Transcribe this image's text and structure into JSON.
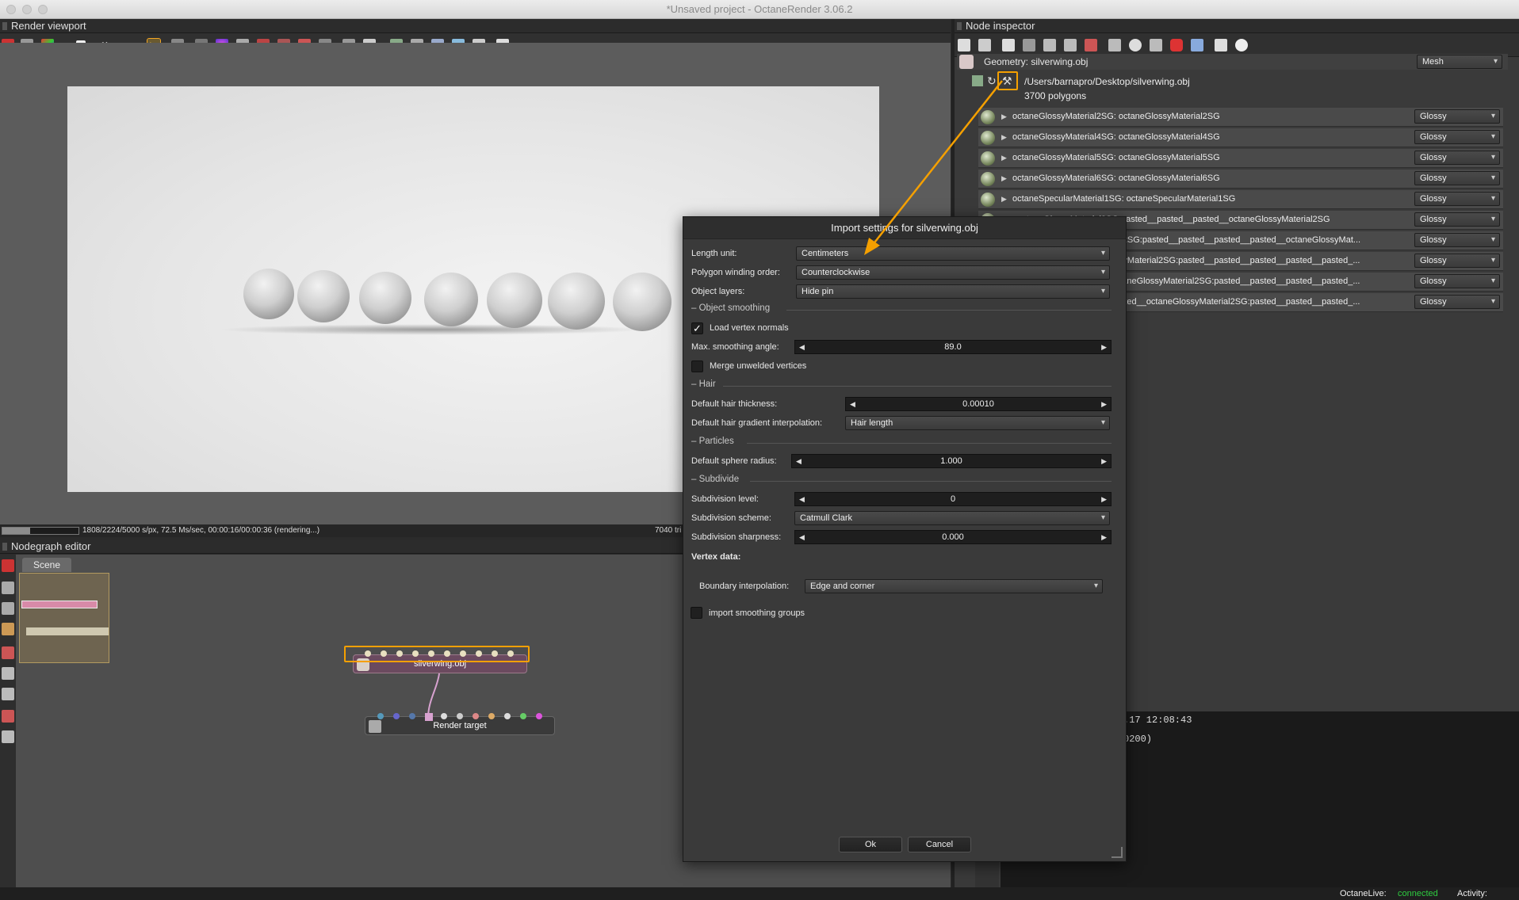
{
  "window": {
    "title": "*Unsaved project - OctaneRender 3.06.2"
  },
  "render_viewport": {
    "title": "Render viewport",
    "status": "1808/2224/5000 s/px, 72.5 Ms/sec, 00:00:16/00:00:36 (rendering...)",
    "status_right": "7040 tri",
    "progress_fraction": 0.36
  },
  "nodegraph": {
    "title": "Nodegraph editor",
    "tab": "Scene",
    "nodes": {
      "geometry": "silverwing.obj",
      "render_target": "Render target"
    }
  },
  "inspector": {
    "title": "Node inspector",
    "geometry_label": "Geometry: silverwing.obj",
    "geometry_type": "Mesh",
    "file_path": "/Users/barnapro/Desktop/silverwing.obj",
    "polygons": "3700 polygons",
    "materials": [
      {
        "label": "octaneGlossyMaterial2SG: octaneGlossyMaterial2SG",
        "type": "Glossy"
      },
      {
        "label": "octaneGlossyMaterial4SG: octaneGlossyMaterial4SG",
        "type": "Glossy"
      },
      {
        "label": "octaneGlossyMaterial5SG: octaneGlossyMaterial5SG",
        "type": "Glossy"
      },
      {
        "label": "octaneGlossyMaterial6SG: octaneGlossyMaterial6SG",
        "type": "Glossy"
      },
      {
        "label": "octaneSpecularMaterial1SG: octaneSpecularMaterial1SG",
        "type": "Glossy"
      },
      {
        "label": "_octaneGlossyMaterial2SG:pasted__pasted__pasted__octaneGlossyMaterial2SG",
        "type": "Glossy"
      },
      {
        "label": "sted__octaneGlossyMaterial2SG:pasted__pasted__pasted__pasted__octaneGlossyMat...",
        "type": "Glossy"
      },
      {
        "label": "sted__pasted__octaneGlossyMaterial2SG:pasted__pasted__pasted__pasted__pasted_...",
        "type": "Glossy"
      },
      {
        "label": "sted__pasted__pasted__octaneGlossyMaterial2SG:pasted__pasted__pasted__pasted_...",
        "type": "Glossy"
      },
      {
        "label": "sted__pasted__pasted__pasted__octaneGlossyMaterial2SG:pasted__pasted__pasted_...",
        "type": "Glossy"
      }
    ]
  },
  "log": {
    "line1": ".17 12:08:43",
    "line2": "0200)"
  },
  "bottom": {
    "live_label": "OctaneLive:",
    "live_status": "connected",
    "activity_label": "Activity:"
  },
  "dialog": {
    "title": "Import settings for silverwing.obj",
    "length_unit_label": "Length unit:",
    "length_unit": "Centimeters",
    "winding_label": "Polygon winding order:",
    "winding": "Counterclockwise",
    "layers_label": "Object layers:",
    "layers": "Hide pin",
    "sec_smoothing": "Object smoothing",
    "load_normals_label": "Load vertex normals",
    "load_normals": true,
    "max_angle_label": "Max. smoothing angle:",
    "max_angle": "89.0",
    "merge_label": "Merge unwelded vertices",
    "merge": false,
    "sec_hair": "Hair",
    "hair_thickness_label": "Default hair thickness:",
    "hair_thickness": "0.00010",
    "hair_interp_label": "Default hair gradient interpolation:",
    "hair_interp": "Hair length",
    "sec_particles": "Particles",
    "sphere_radius_label": "Default sphere radius:",
    "sphere_radius": "1.000",
    "sec_subdivide": "Subdivide",
    "subdiv_level_label": "Subdivision level:",
    "subdiv_level": "0",
    "subdiv_scheme_label": "Subdivision scheme:",
    "subdiv_scheme": "Catmull Clark",
    "subdiv_sharp_label": "Subdivision sharpness:",
    "subdiv_sharp": "0.000",
    "vertex_data_label": "Vertex data:",
    "boundary_label": "Boundary interpolation:",
    "boundary": "Edge and corner",
    "smoothing_groups_label": "import smoothing groups",
    "smoothing_groups": false,
    "ok": "Ok",
    "cancel": "Cancel"
  },
  "colors": {
    "accent": "#f5a000",
    "connected": "#2ecc40"
  }
}
